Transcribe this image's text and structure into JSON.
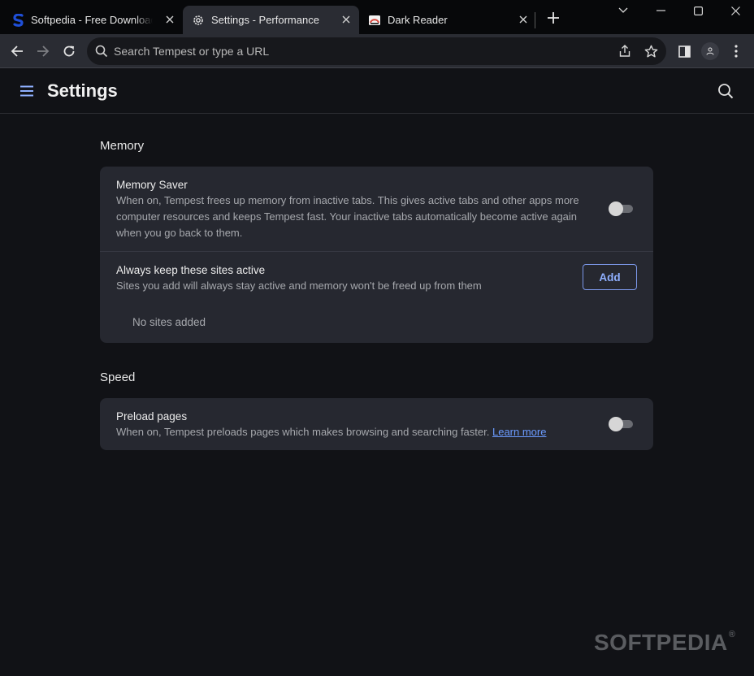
{
  "tabs": [
    {
      "title": "Softpedia - Free Downloads",
      "icon": "softpedia-logo-icon",
      "active": false
    },
    {
      "title": "Settings - Performance",
      "icon": "gear-icon",
      "active": true
    },
    {
      "title": "Dark Reader",
      "icon": "dark-reader-icon",
      "active": false
    }
  ],
  "omnibox": {
    "placeholder": "Search Tempest or type a URL"
  },
  "header": {
    "title": "Settings"
  },
  "memory": {
    "section_title": "Memory",
    "saver_title": "Memory Saver",
    "saver_desc": "When on, Tempest frees up memory from inactive tabs. This gives active tabs and other apps more computer resources and keeps Tempest fast. Your inactive tabs automatically become active again when you go back to them.",
    "saver_enabled": false,
    "keep_title": "Always keep these sites active",
    "keep_desc": "Sites you add will always stay active and memory won't be freed up from them",
    "add_label": "Add",
    "empty_label": "No sites added"
  },
  "speed": {
    "section_title": "Speed",
    "preload_title": "Preload pages",
    "preload_desc": "When on, Tempest preloads pages which makes browsing and searching faster.",
    "learn_more": "Learn more",
    "preload_enabled": false
  },
  "watermark": {
    "text": "SOFTPEDIA",
    "mark": "®"
  },
  "colors": {
    "accent": "#8fb0ff",
    "link": "#6b9bff",
    "background": "#111216",
    "card": "#262830"
  }
}
